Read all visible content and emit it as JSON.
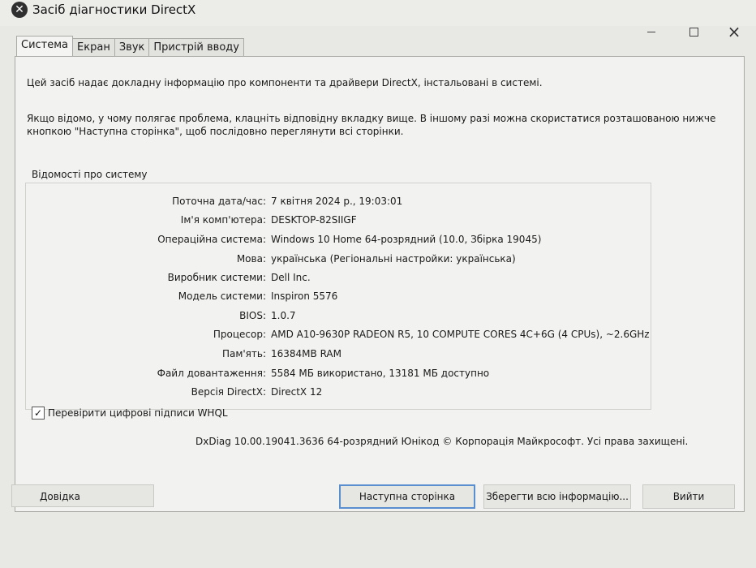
{
  "window": {
    "title": "Засіб діагностики DirectX",
    "icon": "directx-x-icon"
  },
  "tabs": [
    {
      "label": "Система",
      "active": true
    },
    {
      "label": "Екран",
      "active": false
    },
    {
      "label": "Звук",
      "active": false
    },
    {
      "label": "Пристрій вводу",
      "active": false
    }
  ],
  "intro": {
    "line1": "Цей засіб надає докладну інформацію про компоненти та драйвери DirectX, інстальовані в системі.",
    "line2": "Якщо відомо, у чому полягає проблема, клацніть відповідну вкладку вище. В іншому разі можна скористатися розташованою нижче кнопкою \"Наступна сторінка\", щоб послідовно переглянути всі сторінки."
  },
  "system_info": {
    "section_label": "Відомості про систему",
    "rows": [
      {
        "key": "Поточна дата/час:",
        "value": "7 квітня 2024 р., 19:03:01"
      },
      {
        "key": "Ім'я комп'ютера:",
        "value": "DESKTOP-82SIIGF"
      },
      {
        "key": "Операційна система:",
        "value": "Windows 10 Home 64-розрядний (10.0, Збірка 19045)"
      },
      {
        "key": "Мова:",
        "value": "українська (Регіональні настройки: українська)"
      },
      {
        "key": "Виробник системи:",
        "value": "Dell Inc."
      },
      {
        "key": "Модель системи:",
        "value": "Inspiron 5576"
      },
      {
        "key": "BIOS:",
        "value": "1.0.7"
      },
      {
        "key": "Процесор:",
        "value": "AMD A10-9630P RADEON R5, 10 COMPUTE CORES 4C+6G (4 CPUs), ~2.6GHz"
      },
      {
        "key": "Пам'ять:",
        "value": "16384MB RAM"
      },
      {
        "key": "Файл довантаження:",
        "value": "5584 МБ використано, 13181 МБ доступно"
      },
      {
        "key": "Версія DirectX:",
        "value": "DirectX 12"
      }
    ]
  },
  "whql": {
    "label": "Перевірити цифрові підписи WHQL",
    "checked": true
  },
  "copyright": "DxDiag 10.00.19041.3636 64-розрядний Юнікод  © Корпорація Майкрософт. Усі права захищені.",
  "buttons": {
    "help": "Довідка",
    "next": "Наступна сторінка",
    "save": "Зберегти всю інформацію...",
    "exit": "Вийти"
  }
}
